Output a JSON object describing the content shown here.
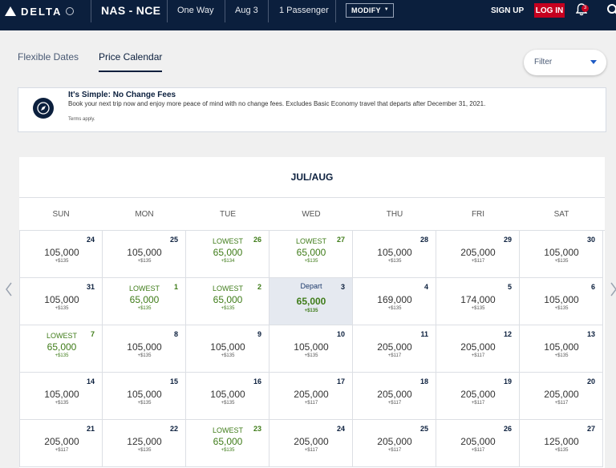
{
  "header": {
    "logo_text": "DELTA",
    "route": "NAS - NCE",
    "trip_type": "One Way",
    "date": "Aug 3",
    "passengers": "1 Passenger",
    "modify_label": "MODIFY",
    "signup_label": "SIGN UP",
    "login_label": "LOG IN",
    "notification_count": "3",
    "icons": [
      "delta-logo-icon",
      "globe-icon",
      "bell-icon",
      "search-icon"
    ]
  },
  "tabs": [
    {
      "label": "Flexible Dates",
      "active": false
    },
    {
      "label": "Price Calendar",
      "active": true
    }
  ],
  "filter": {
    "label": "Filter"
  },
  "banner": {
    "title": "It's Simple: No Change Fees",
    "body": "Book your next trip now and enjoy more peace of mind with no change fees. Excludes Basic Economy travel that departs after December 31, 2021.",
    "terms": "Terms apply."
  },
  "calendar": {
    "month": "JUL/AUG",
    "weekdays": [
      "SUN",
      "MON",
      "TUE",
      "WED",
      "THU",
      "FRI",
      "SAT"
    ],
    "rows": [
      [
        {
          "day": "24",
          "price": "105,000",
          "tax": "+$135"
        },
        {
          "day": "25",
          "price": "105,000",
          "tax": "+$135"
        },
        {
          "day": "26",
          "tag": "LOWEST",
          "price": "65,000",
          "tax": "+$134",
          "lowest": true
        },
        {
          "day": "27",
          "tag": "LOWEST",
          "price": "65,000",
          "tax": "+$135",
          "lowest": true
        },
        {
          "day": "28",
          "price": "105,000",
          "tax": "+$135"
        },
        {
          "day": "29",
          "price": "205,000",
          "tax": "+$117"
        },
        {
          "day": "30",
          "price": "105,000",
          "tax": "+$135"
        }
      ],
      [
        {
          "day": "31",
          "price": "105,000",
          "tax": "+$135"
        },
        {
          "day": "1",
          "tag": "LOWEST",
          "price": "65,000",
          "tax": "+$135",
          "lowest": true
        },
        {
          "day": "2",
          "tag": "LOWEST",
          "price": "65,000",
          "tax": "+$135",
          "lowest": true
        },
        {
          "day": "3",
          "tag": "Depart",
          "price": "65,000",
          "tax": "+$135",
          "selected": true
        },
        {
          "day": "4",
          "price": "169,000",
          "tax": "+$135"
        },
        {
          "day": "5",
          "price": "174,000",
          "tax": "+$135"
        },
        {
          "day": "6",
          "price": "105,000",
          "tax": "+$135"
        }
      ],
      [
        {
          "day": "7",
          "tag": "LOWEST",
          "price": "65,000",
          "tax": "+$135",
          "lowest": true
        },
        {
          "day": "8",
          "price": "105,000",
          "tax": "+$135"
        },
        {
          "day": "9",
          "price": "105,000",
          "tax": "+$135"
        },
        {
          "day": "10",
          "price": "105,000",
          "tax": "+$135"
        },
        {
          "day": "11",
          "price": "205,000",
          "tax": "+$117"
        },
        {
          "day": "12",
          "price": "205,000",
          "tax": "+$117"
        },
        {
          "day": "13",
          "price": "105,000",
          "tax": "+$135"
        }
      ],
      [
        {
          "day": "14",
          "price": "105,000",
          "tax": "+$135"
        },
        {
          "day": "15",
          "price": "105,000",
          "tax": "+$135"
        },
        {
          "day": "16",
          "price": "105,000",
          "tax": "+$135"
        },
        {
          "day": "17",
          "price": "205,000",
          "tax": "+$117"
        },
        {
          "day": "18",
          "price": "205,000",
          "tax": "+$117"
        },
        {
          "day": "19",
          "price": "205,000",
          "tax": "+$117"
        },
        {
          "day": "20",
          "price": "205,000",
          "tax": "+$117"
        }
      ],
      [
        {
          "day": "21",
          "price": "205,000",
          "tax": "+$117"
        },
        {
          "day": "22",
          "price": "125,000",
          "tax": "+$135"
        },
        {
          "day": "23",
          "tag": "LOWEST",
          "price": "65,000",
          "tax": "+$135",
          "lowest": true
        },
        {
          "day": "24",
          "price": "205,000",
          "tax": "+$117"
        },
        {
          "day": "25",
          "price": "205,000",
          "tax": "+$117"
        },
        {
          "day": "26",
          "price": "205,000",
          "tax": "+$117"
        },
        {
          "day": "27",
          "price": "125,000",
          "tax": "+$135"
        }
      ]
    ]
  },
  "colors": {
    "navy": "#0b1f3d",
    "accent_red": "#c5001f",
    "lowest_green": "#3f7c19",
    "selected_bg": "#e5e9f0"
  }
}
